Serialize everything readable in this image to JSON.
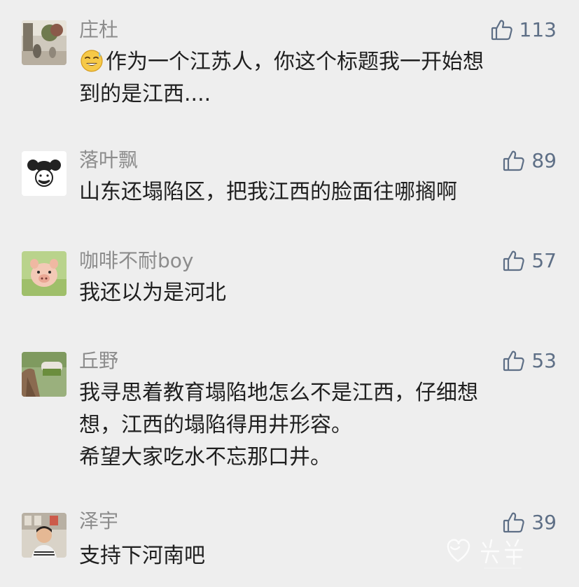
{
  "colors": {
    "background": "#eeeeee",
    "username": "#8c8c8c",
    "like_count": "#5e6f86",
    "comment_text": "#1f1f1f"
  },
  "icons": {
    "like": "thumbs-up-outline-icon",
    "emoji": "sweat-smile-emoji-icon"
  },
  "comments": [
    {
      "username": "庄杜",
      "likes": "113",
      "lines": [
        "作为一个江苏人，你这个标题我一开始想",
        "到的是江西...."
      ]
    },
    {
      "username": "落叶飘",
      "likes": "89",
      "lines": [
        "山东还塌陷区，把我江西的脸面往哪搁啊"
      ]
    },
    {
      "username": "咖啡不耐boy",
      "likes": "57",
      "lines": [
        "我还以为是河北"
      ]
    },
    {
      "username": "丘野",
      "likes": "53",
      "lines": [
        "我寻思着教育塌陷地怎么不是江西，仔细想",
        "想，江西的塌陷得用井形容。",
        "希望大家吃水不忘那口井。"
      ]
    },
    {
      "username": "泽宇",
      "likes": "39",
      "lines": [
        "支持下河南吧"
      ]
    }
  ]
}
